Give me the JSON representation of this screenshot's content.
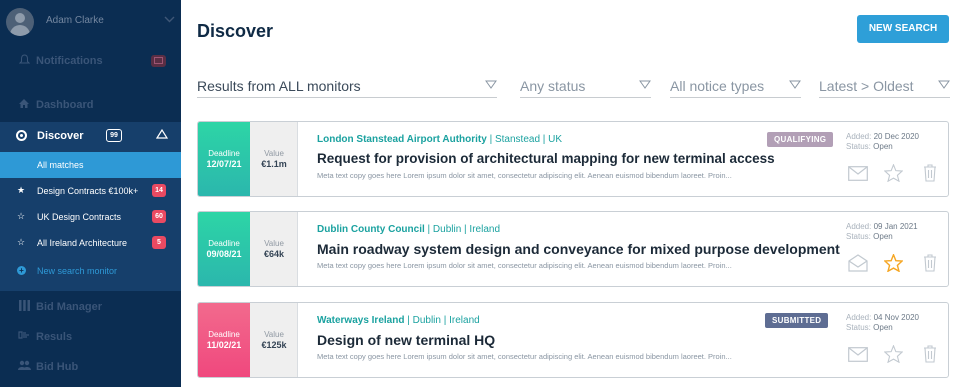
{
  "user": {
    "name": "Adam Clarke"
  },
  "nav": {
    "notifications": {
      "label": "Notifications"
    },
    "dashboard": {
      "label": "Dashboard"
    },
    "discover": {
      "label": "Discover",
      "count": "99"
    },
    "sub_items": [
      {
        "label": "All matches",
        "badge": ""
      },
      {
        "label": "Design Contracts €100k+",
        "badge": "14"
      },
      {
        "label": "UK Design Contracts",
        "badge": "60"
      },
      {
        "label": "All Ireland Architecture",
        "badge": "5"
      },
      {
        "label": "New search monitor",
        "badge": ""
      }
    ],
    "bid_manager": {
      "label": "Bid Manager"
    },
    "results": {
      "label": "Resuls"
    },
    "bid_hub": {
      "label": "Bid Hub"
    }
  },
  "page": {
    "title": "Discover",
    "new_search_label": "NEW SEARCH"
  },
  "filters": {
    "monitors": "Results from ALL monitors",
    "status": "Any status",
    "notice_types": "All notice types",
    "sort": "Latest > Oldest"
  },
  "cards": [
    {
      "deadline_label": "Deadline",
      "deadline": "12/07/21",
      "value_label": "Value",
      "value": "€1.1m",
      "org": "London Stanstead Airport Authority",
      "location": " | Stanstead | UK",
      "title": "Request for provision of architectural mapping for new terminal access",
      "meta": "Meta text copy goes here Lorem ipsum dolor sit amet, consectetur adipiscing elit. Aenean euismod bibendum laoreet. Proin...",
      "tag": "QUALIFYING",
      "added_label": "Added:",
      "added": "20 Dec 2020",
      "status_label": "Status:",
      "status": "Open",
      "starred": false
    },
    {
      "deadline_label": "Deadline",
      "deadline": "09/08/21",
      "value_label": "Value",
      "value": "€64k",
      "org": "Dublin County Council",
      "location": " | Dublin | Ireland",
      "title": "Main roadway system design and conveyance for mixed purpose development",
      "meta": "Meta text copy goes here Lorem ipsum dolor sit amet, consectetur adipiscing elit. Aenean euismod bibendum laoreet. Proin...",
      "tag": "",
      "added_label": "Added:",
      "added": "09 Jan 2021",
      "status_label": "Status:",
      "status": "Open",
      "starred": true
    },
    {
      "deadline_label": "Deadline",
      "deadline": "11/02/21",
      "value_label": "Value",
      "value": "€125k",
      "org": "Waterways Ireland",
      "location": " | Dublin | Ireland",
      "title": "Design of new terminal HQ",
      "meta": "Meta text copy goes here Lorem ipsum dolor sit amet, consectetur adipiscing elit. Aenean euismod bibendum laoreet. Proin...",
      "tag": "SUBMITTED",
      "added_label": "Added:",
      "added": "04 Nov 2020",
      "status_label": "Status:",
      "status": "Open",
      "starred": false
    }
  ],
  "colors": {
    "sidebar": "#0b2d52",
    "accent": "#2e9fd8",
    "star_active": "#f5a623"
  }
}
